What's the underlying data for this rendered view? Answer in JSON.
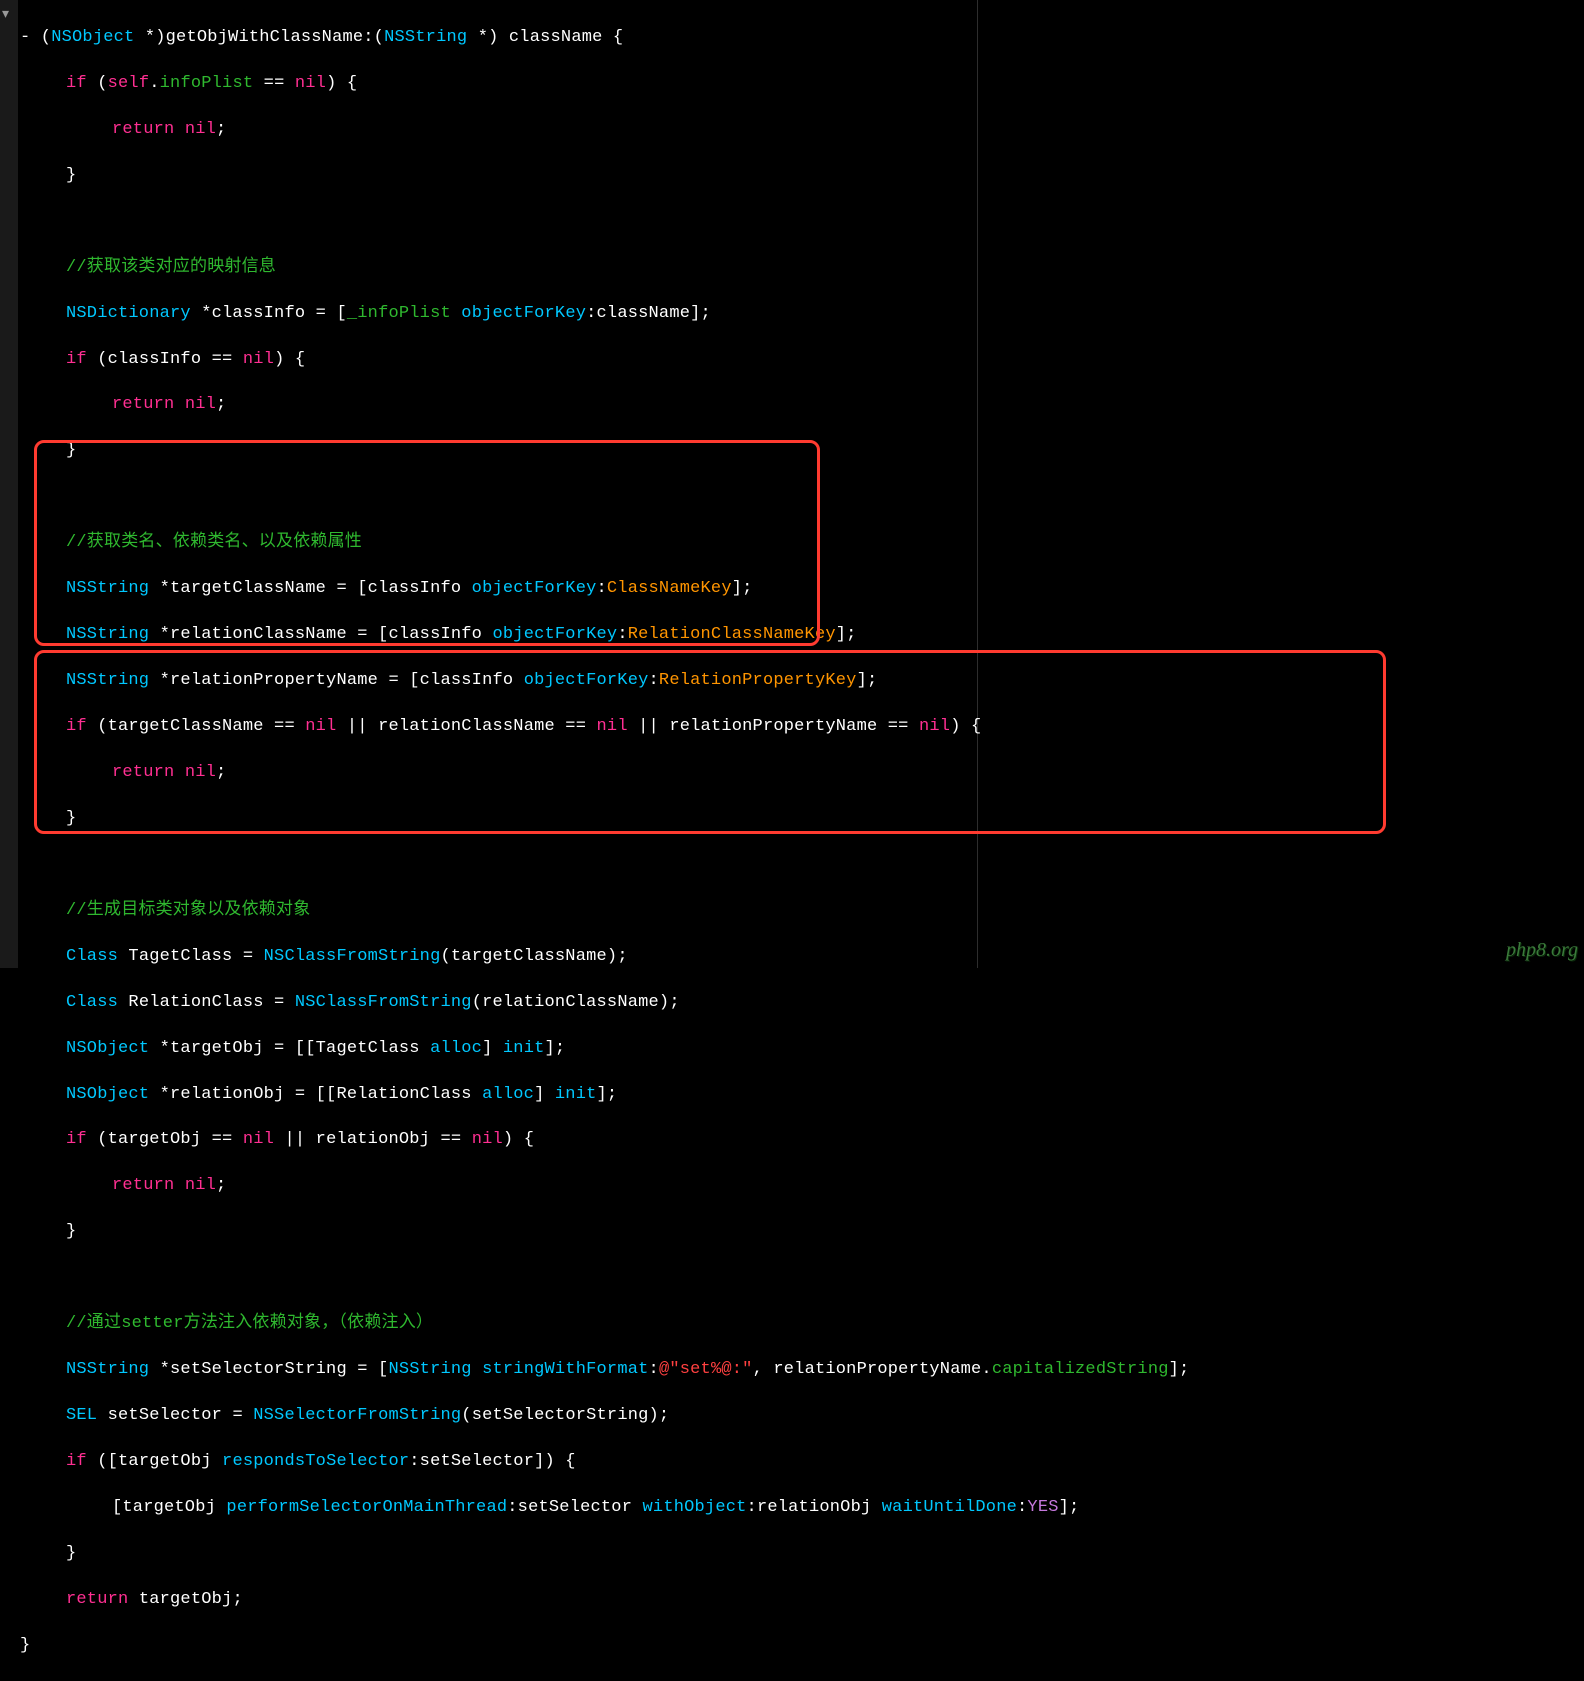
{
  "code": {
    "line1_pre": "- (",
    "line1_type1": "NSObject",
    "line1_mid1": " *)getObjWithClassName:(",
    "line1_type2": "NSString",
    "line1_mid2": " *) className {",
    "line2_if": "if",
    "line2_open": " (",
    "line2_self": "self",
    "line2_dot": ".",
    "line2_prop": "infoPlist",
    "line2_eq": " == ",
    "line2_nil": "nil",
    "line2_close": ") {",
    "line3_return": "return",
    "line3_sp": " ",
    "line3_nil": "nil",
    "line3_semi": ";",
    "line4_brace": "}",
    "blank": "",
    "comment1": "//获取该类对应的映射信息",
    "line6_type": "NSDictionary",
    "line6_mid1": " *classInfo = [",
    "line6_ivar": "_infoPlist",
    "line6_sp": " ",
    "line6_sel": "objectForKey",
    "line6_mid2": ":className];",
    "line7_if": "if",
    "line7_body": " (classInfo == ",
    "line7_nil": "nil",
    "line7_close": ") {",
    "comment2": "//获取类名、依赖类名、以及依赖属性",
    "line9_type": "NSString",
    "line9_body1": " *targetClassName = [classInfo ",
    "line9_sel": "objectForKey",
    "line9_colon": ":",
    "line9_key": "ClassNameKey",
    "line9_end": "];",
    "line10_body1": " *relationClassName = [classInfo ",
    "line10_key": "RelationClassNameKey",
    "line11_body1": " *relationPropertyName = [classInfo ",
    "line11_key": "RelationPropertyKey",
    "line12_if": "if",
    "line12_open": " (targetClassName == ",
    "line12_nil": "nil",
    "line12_or1": " || relationClassName == ",
    "line12_or2": " || relationPropertyName == ",
    "line12_close": ") {",
    "comment3": "//生成目标类对象以及依赖对象",
    "line14_class": "Class",
    "line14_body": " TagetClass = ",
    "line14_fn": "NSClassFromString",
    "line14_arg": "(targetClassName);",
    "line15_body": " RelationClass = ",
    "line15_arg": "(relationClassName);",
    "line16_type": "NSObject",
    "line16_body": " *targetObj = [[TagetClass ",
    "line16_alloc": "alloc",
    "line16_mid": "] ",
    "line16_init": "init",
    "line16_end": "];",
    "line17_body": " *relationObj = [[RelationClass ",
    "line18_if": "if",
    "line18_open": " (targetObj == ",
    "line18_or": " || relationObj == ",
    "line18_close": ") {",
    "comment4": "//通过setter方法注入依赖对象，（依赖注入）",
    "line20_body": " *setSelectorString = [",
    "line20_ns": "NSString",
    "line20_sp": " ",
    "line20_sel": "stringWithFormat",
    "line20_colon": ":",
    "line20_str": "@\"set%@:\"",
    "line20_mid": ", relationPropertyName.",
    "line20_cap": "capitalizedString",
    "line20_end": "];",
    "line21_sel": "SEL",
    "line21_body": " setSelector = ",
    "line21_fn": "NSSelectorFromString",
    "line21_arg": "(setSelectorString);",
    "line22_if": "if",
    "line22_open": " ([targetObj ",
    "line22_sel": "respondsToSelector",
    "line22_close": ":setSelector]) {",
    "line23_open": "[targetObj ",
    "line23_sel1": "performSelectorOnMainThread",
    "line23_mid1": ":setSelector ",
    "line23_sel2": "withObject",
    "line23_mid2": ":relationObj ",
    "line23_sel3": "waitUntilDone",
    "line23_colon": ":",
    "line23_yes": "YES",
    "line23_end": "];",
    "line24_brace": "}",
    "line25_return": "return",
    "line25_body": " targetObj;",
    "line26_brace": "}"
  },
  "watermark": "php8.org",
  "fold_glyph": "▾"
}
